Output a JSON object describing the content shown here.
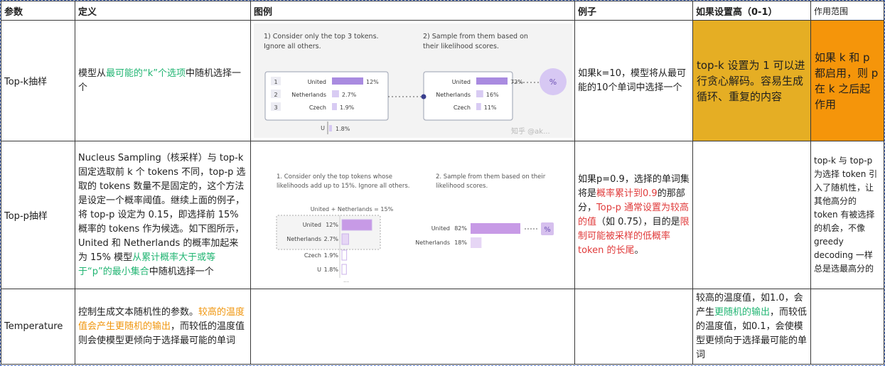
{
  "headers": {
    "param": "参数",
    "definition": "定义",
    "illustration": "图例",
    "example": "例子",
    "if_high": "如果设置高（0-1）",
    "scope": "作用范围"
  },
  "rows": {
    "topk": {
      "name": "Top-k抽样",
      "def_a": "模型从",
      "def_b": "最可能的“k”个选项",
      "def_c": "中随机选择一个",
      "example": "如果k=10，模型将从最可能的10个单词中选择一个",
      "if_high": "top-k 设置为 1 可以进行贪心解码。容易生成循环、重复的内容",
      "scope": "如果 k 和 p 都启用，则 p 在 k 之后起作用"
    },
    "topp": {
      "name": "Top-p抽样",
      "def_a": " Nucleus Sampling（核采样）与 top-k 固定选取前 k 个 tokens 不同，top-p 选取的 tokens 数量不是固定的，这个方法是设定一个概率阈值。继续上面的例子，将 top-p 设定为 0.15，即选择前 15% 概率的 tokens 作为候选。如下图所示，United 和 Netherlands 的概率加起来为 15% 模型",
      "def_b": "从累计概率大于或等于“p”的最小集合",
      "def_c": "中随机选择一个",
      "ex_a": "如果p=0.9，选择的单词集将是",
      "ex_b": "概率累计到0.9",
      "ex_c": "的那部分，",
      "ex_d": "Top-p 通常设置为较高的值",
      "ex_e": "（如 0.75），目的是",
      "ex_f": "限制可能被采样的低概率 token 的长尾",
      "ex_g": "。",
      "if_high": "",
      "scope": "top-k 与 top-p 为选择 token 引入了随机性，让其他高分的 token 有被选择的机会，不像 greedy decoding 一样总是选最高分的"
    },
    "temp": {
      "name": "Temperature",
      "def_a": "控制生成文本随机性的参数。",
      "def_b": "较高的温度值会产生更随机的输出",
      "def_c": "，而较低的温度值则会使模型更倾向于选择最可能的单词",
      "if_a": "较高的温度值，如1.0，会产生",
      "if_b": "更随机的输出",
      "if_c": "，而较低的温度值，如0.1，会使模型更倾向于选择最可能的单词"
    }
  },
  "figure1": {
    "step1_l1": "1) Consider only the top 3 tokens.",
    "step1_l2": "Ignore all others.",
    "step2_l1": "2) Sample from them based on",
    "step2_l2": "their likelihood scores.",
    "left": [
      {
        "idx": "1",
        "token": "United",
        "pct": "12%",
        "value": 12
      },
      {
        "idx": "2",
        "token": "Netherlands",
        "pct": "2.7%",
        "value": 2.7
      },
      {
        "idx": "3",
        "token": "Czech",
        "pct": "1.9%",
        "value": 1.9
      }
    ],
    "extra": {
      "token": "U",
      "pct": "1.8%"
    },
    "right": [
      {
        "token": "United",
        "pct": "72%",
        "value": 72
      },
      {
        "token": "Netherlands",
        "pct": "16%",
        "value": 16
      },
      {
        "token": "Czech",
        "pct": "11%",
        "value": 11
      }
    ],
    "circle": "%",
    "watermark": "知乎 @ak..."
  },
  "figure2": {
    "step1_l1": "1. Consider only the top tokens whose",
    "step1_l2": "likelihoods add up to 15%. Ignore all others.",
    "step2_l1": "2. Sample from them based on their",
    "step2_l2": "likelihood scores.",
    "sum_label": "United + Netherlands = 15%",
    "left": [
      {
        "token": "United",
        "pct": "12%",
        "value": 12
      },
      {
        "token": "Netherlands",
        "pct": "2.7%",
        "value": 2.7
      },
      {
        "token": "Czech",
        "pct": "1.9%",
        "value": 1.9
      },
      {
        "token": "U",
        "pct": "1.8%",
        "value": 1.8
      }
    ],
    "right": [
      {
        "token": "United",
        "pct": "82%",
        "value": 82
      },
      {
        "token": "Netherlands",
        "pct": "18%",
        "value": 18
      }
    ],
    "ellipsis": "...",
    "circle": "%"
  }
}
